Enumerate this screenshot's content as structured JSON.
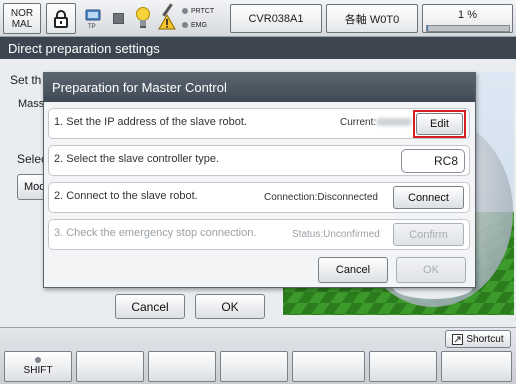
{
  "top_bar": {
    "mode_line1": "NOR",
    "mode_line2": "MAL",
    "tp_label": "TP",
    "prtct_label": "PRTCT",
    "emg_label": "EMG",
    "robot_name": "CVR038A1",
    "axis_label": "各軸 W0T0",
    "speed_label": "1 %"
  },
  "screen_title": "Direct preparation settings",
  "background": {
    "set_text": "Set th",
    "mass_text": "Mass",
    "select_text": "Selec",
    "mode_text": "Mod",
    "cancel_label": "Cancel",
    "ok_label": "OK"
  },
  "dialog": {
    "title": "Preparation for Master Control",
    "row1": {
      "text": "1. Set the IP address of the slave robot.",
      "current_label": "Current:",
      "edit_label": "Edit"
    },
    "row2": {
      "text": "2. Select the slave controller type.",
      "value": "RC8"
    },
    "row3": {
      "text": "2. Connect to the slave robot.",
      "status": "Connection:Disconnected",
      "connect_label": "Connect"
    },
    "row4": {
      "text": "3. Check the emergency stop connection.",
      "status": "Status:Unconfirmed",
      "confirm_label": "Confirm"
    },
    "cancel_label": "Cancel",
    "ok_label": "OK"
  },
  "bottom": {
    "shortcut_label": "Shortcut",
    "shift_label": "SHIFT"
  },
  "colors": {
    "title_bar": "#3d4650",
    "dialog_header": "#495460",
    "edit_highlight": "#d42020",
    "viewport_green": "#3c9a2a"
  }
}
